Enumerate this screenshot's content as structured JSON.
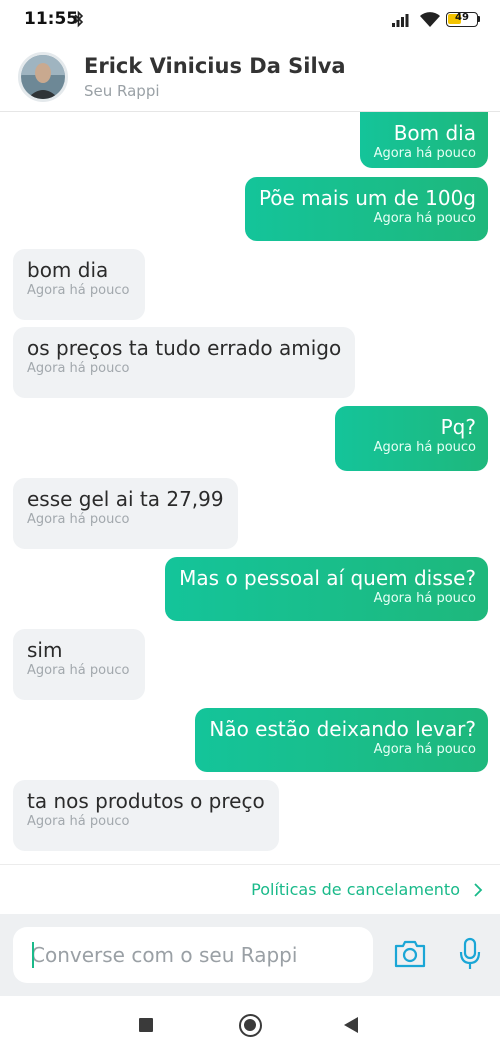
{
  "status_bar": {
    "time": "11:55",
    "battery": "49",
    "battery_level": 0.49,
    "icons": [
      "bluetooth-icon",
      "signal-icon",
      "wifi-icon",
      "battery-icon"
    ]
  },
  "header": {
    "contact_name": "Erick Vinicius Da Silva",
    "subtitle": "Seu Rappi"
  },
  "colors": {
    "accent": "#1ABA8A",
    "sent_bubble_start": "#14C49A",
    "sent_bubble_end": "#1EB87C",
    "received_bubble": "#F0F2F4"
  },
  "messages": [
    {
      "direction": "sent",
      "text": "Bom dia",
      "time": "Agora há pouco"
    },
    {
      "direction": "sent",
      "text": "Põe mais um de 100g",
      "time": "Agora há pouco"
    },
    {
      "direction": "received",
      "text": "bom dia",
      "time": "Agora há pouco"
    },
    {
      "direction": "received",
      "text": "os preços ta tudo errado amigo",
      "time": "Agora há pouco"
    },
    {
      "direction": "sent",
      "text": "Pq?",
      "time": "Agora há pouco"
    },
    {
      "direction": "received",
      "text": "esse gel ai ta 27,99",
      "time": "Agora há pouco"
    },
    {
      "direction": "sent",
      "text": "Mas o pessoal aí quem disse?",
      "time": "Agora há pouco"
    },
    {
      "direction": "received",
      "text": "sim",
      "time": "Agora há pouco"
    },
    {
      "direction": "sent",
      "text": "Não estão deixando levar?",
      "time": "Agora há pouco"
    },
    {
      "direction": "received",
      "text": "ta nos produtos o preço",
      "time": "Agora há pouco"
    }
  ],
  "policy_link": "Políticas de cancelamento",
  "composer": {
    "placeholder": "Converse com o seu Rappi",
    "value": ""
  },
  "nav": {
    "icons": [
      "recents-icon",
      "home-icon",
      "back-icon"
    ]
  }
}
